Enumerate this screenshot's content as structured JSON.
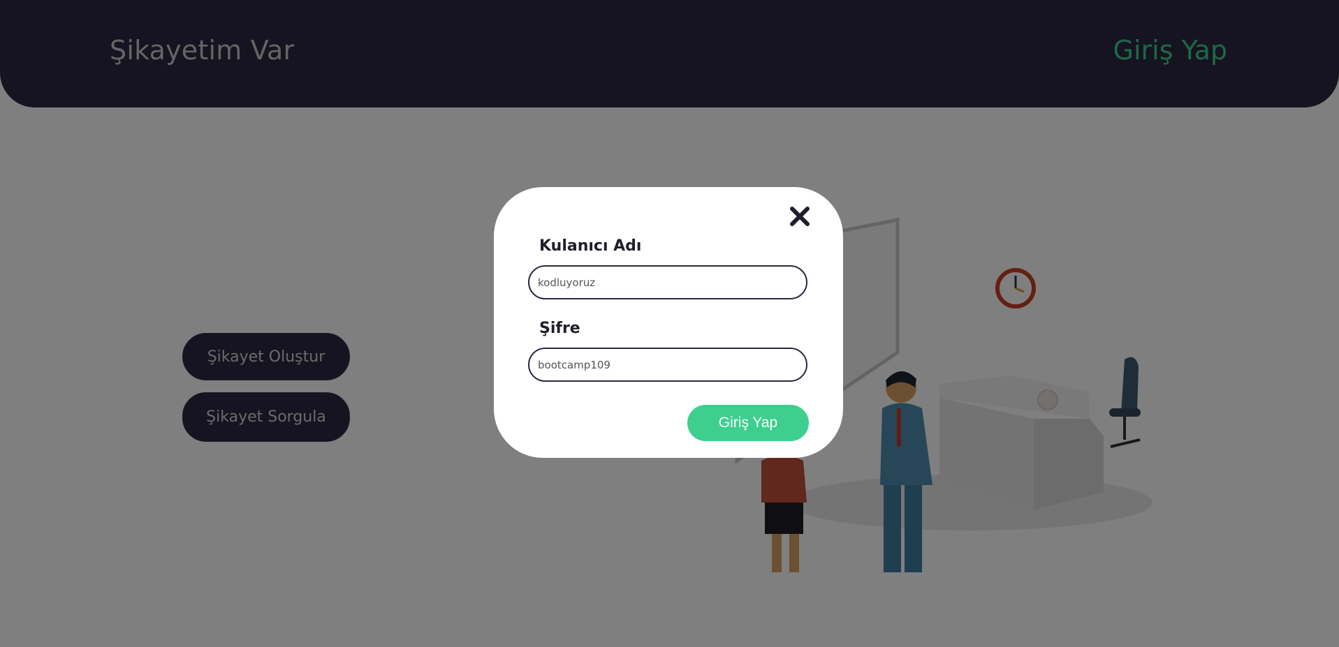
{
  "header": {
    "brand": "Şikayetim Var",
    "login_link": "Giriş Yap"
  },
  "actions": {
    "create_label": "Şikayet Oluştur",
    "query_label": "Şikayet Sorgula"
  },
  "illustration": {
    "description_icon": "office-reception-illustration"
  },
  "modal": {
    "close_icon": "close-icon",
    "username_label": "Kulanıcı Adı",
    "username_value": "kodluyoruz",
    "password_label": "Şifre",
    "password_value": "bootcamp109",
    "submit_label": "Giriş Yap"
  },
  "colors": {
    "header_bg": "#2a2940",
    "accent": "#3ecf8e",
    "overlay": "rgba(0,0,0,0.5)"
  }
}
